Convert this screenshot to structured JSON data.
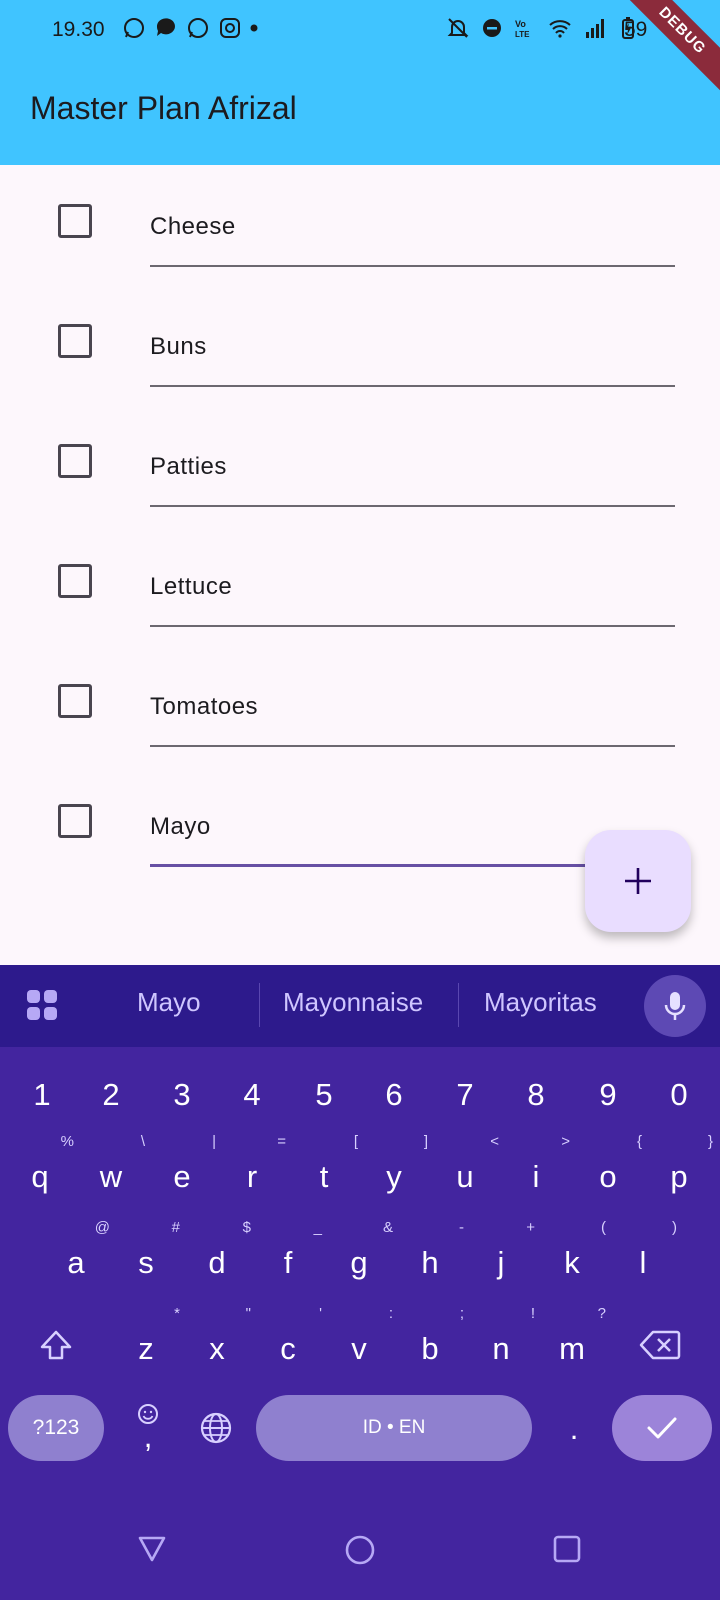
{
  "status": {
    "time": "19.30",
    "battery": "59"
  },
  "app": {
    "title": "Master Plan Afrizal",
    "debug": "DEBUG"
  },
  "tasks": [
    {
      "text": "Cheese",
      "checked": false
    },
    {
      "text": "Buns",
      "checked": false
    },
    {
      "text": "Patties",
      "checked": false
    },
    {
      "text": "Lettuce",
      "checked": false
    },
    {
      "text": "Tomatoes",
      "checked": false
    },
    {
      "text": "Mayo",
      "checked": false,
      "focused": true
    }
  ],
  "fab": {
    "icon": "plus-icon"
  },
  "keyboard": {
    "suggestions": [
      "Mayo",
      "Mayonnaise",
      "Mayoritas"
    ],
    "number_row": [
      "1",
      "2",
      "3",
      "4",
      "5",
      "6",
      "7",
      "8",
      "9",
      "0"
    ],
    "row1": [
      "q",
      "w",
      "e",
      "r",
      "t",
      "y",
      "u",
      "i",
      "o",
      "p"
    ],
    "row1_hints": [
      "%",
      "\\",
      "|",
      "=",
      "[",
      "]",
      "<",
      ">",
      "{",
      "}"
    ],
    "row2": [
      "a",
      "s",
      "d",
      "f",
      "g",
      "h",
      "j",
      "k",
      "l"
    ],
    "row2_hints": [
      "@",
      "#",
      "$",
      "_",
      "&",
      "-",
      "+",
      "(",
      ")"
    ],
    "row3": [
      "z",
      "x",
      "c",
      "v",
      "b",
      "n",
      "m"
    ],
    "row3_hints": [
      "*",
      "\"",
      "'",
      ":",
      ";",
      "!",
      "?"
    ],
    "symbols_label": "?123",
    "comma": ",",
    "space_label": "ID • EN",
    "period": "."
  }
}
